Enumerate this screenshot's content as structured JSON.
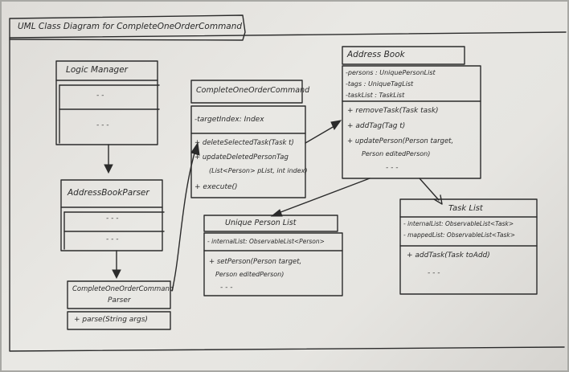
{
  "diagram_title": "UML Class Diagram for CompleteOneOrderCommand",
  "classes": {
    "logic_manager": {
      "name": "Logic Manager",
      "section1": "- -",
      "section2": "- - -"
    },
    "address_book_parser": {
      "name": "AddressBookParser",
      "section1": "- - -",
      "section2": "- - -"
    },
    "complete_parser": {
      "name_line1": "CompleteOneOrderCommand",
      "name_line2": "Parser",
      "method": "+ parse(String args)"
    },
    "complete_command": {
      "name": "CompleteOneOrderCommand",
      "attribute": "-targetIndex: Index",
      "methods": [
        "+ deleteSelectedTask(Task t)",
        "+ updateDeletedPersonTag",
        "(List<Person> pList, int index)",
        "+ execute()"
      ]
    },
    "address_book": {
      "name": "Address Book",
      "attributes": [
        "-persons : UniquePersonList",
        "-tags : UniqueTagList",
        "-taskList : TaskList"
      ],
      "methods": [
        "+ removeTask(Task task)",
        "+ addTag(Tag t)",
        "+ updatePerson(Person target,",
        "Person editedPerson)",
        "- - -"
      ]
    },
    "unique_person_list": {
      "name": "Unique Person List",
      "attribute": "- internalList: ObservableList<Person>",
      "methods": [
        "+ setPerson(Person target,",
        "Person editedPerson)",
        "- - -"
      ]
    },
    "task_list": {
      "name": "Task List",
      "attributes": [
        "- internalList: ObservableList<Task>",
        "- mappedList: ObservableList<Task>"
      ],
      "methods": [
        "+ addTask(Task toAdd)",
        "- - -"
      ]
    }
  }
}
